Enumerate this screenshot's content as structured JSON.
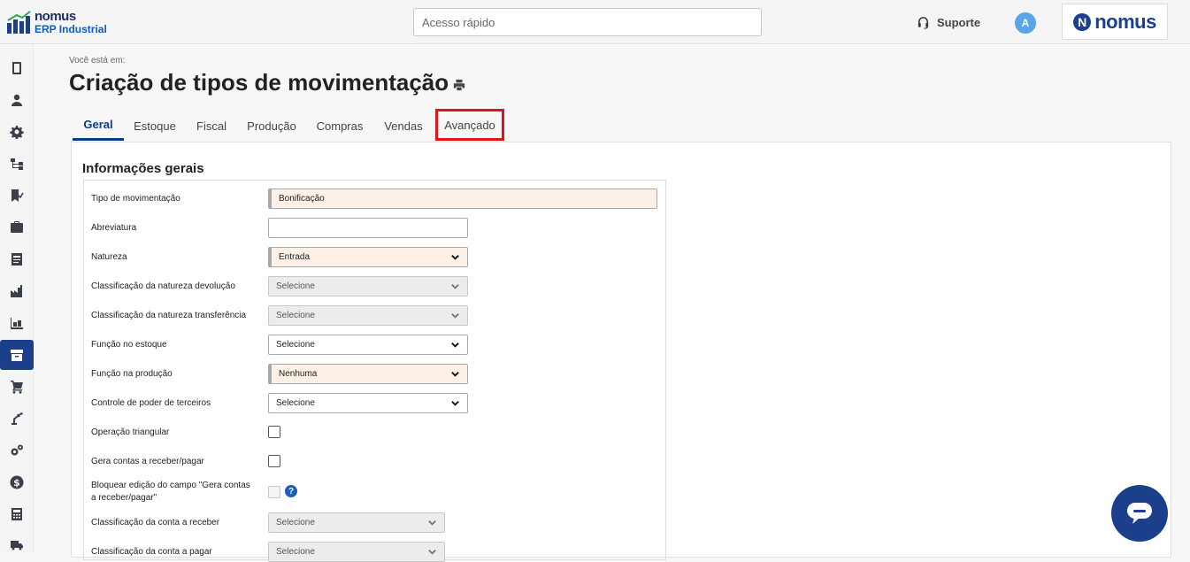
{
  "header": {
    "logo_line1": "nomus",
    "logo_line2": "ERP Industrial",
    "quick_access_placeholder": "Acesso rápido",
    "support_label": "Suporte",
    "avatar_initial": "A",
    "brand_letter": "N",
    "brand_name": "nomus"
  },
  "sidebar": {
    "items": [
      {
        "icon": "book-icon"
      },
      {
        "icon": "user-icon"
      },
      {
        "icon": "gear-icon"
      },
      {
        "icon": "workflow-icon"
      },
      {
        "icon": "bookmark-check-icon"
      },
      {
        "icon": "briefcase-icon"
      },
      {
        "icon": "report-icon"
      },
      {
        "icon": "factory-icon"
      },
      {
        "icon": "inventory-icon"
      },
      {
        "icon": "archive-icon",
        "active": true
      },
      {
        "icon": "cart-icon"
      },
      {
        "icon": "robot-arm-icon"
      },
      {
        "icon": "gears-icon"
      },
      {
        "icon": "dollar-icon"
      },
      {
        "icon": "calculator-icon"
      },
      {
        "icon": "truck-icon"
      }
    ]
  },
  "page": {
    "breadcrumb": "Você está em:",
    "title": "Criação de tipos de movimentação"
  },
  "tabs": [
    "Geral",
    "Estoque",
    "Fiscal",
    "Produção",
    "Compras",
    "Vendas",
    "Avançado"
  ],
  "active_tab": "Geral",
  "highlighted_tab": "Avançado",
  "form": {
    "section_title": "Informações gerais",
    "fields": [
      {
        "label": "Tipo de movimentação",
        "value": "Bonificação"
      },
      {
        "label": "Abreviatura",
        "value": ""
      },
      {
        "label": "Natureza",
        "value": "Entrada"
      },
      {
        "label": "Classificação da natureza devolução",
        "value": "Selecione"
      },
      {
        "label": "Classificação da natureza transferência",
        "value": "Selecione"
      },
      {
        "label": "Função no estoque",
        "value": "Selecione"
      },
      {
        "label": "Função na produção",
        "value": "Nenhuma"
      },
      {
        "label": "Controle de poder de terceiros",
        "value": "Selecione"
      },
      {
        "label": "Operação triangular"
      },
      {
        "label": "Gera contas a receber/pagar"
      },
      {
        "label": "Bloquear edição do campo \"Gera contas a receber/pagar\""
      },
      {
        "label": "Classificação da conta a receber",
        "value": "Selecione"
      },
      {
        "label": "Classificação da conta a pagar",
        "value": "Selecione"
      }
    ]
  },
  "colors": {
    "brand": "#1b3f8b",
    "tab_active": "#0a3c8c",
    "highlight_box": "#e0151c",
    "required_bg": "#fdf0e6"
  }
}
